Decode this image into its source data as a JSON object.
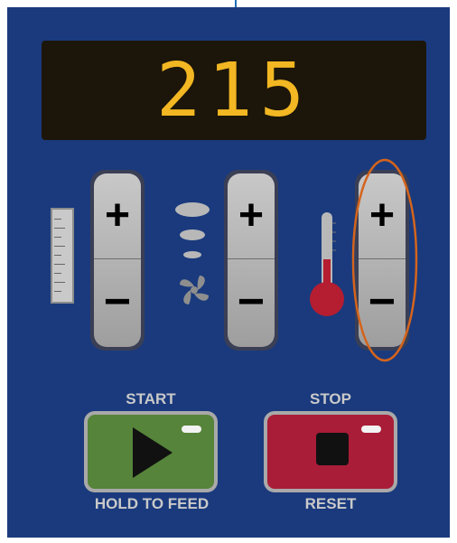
{
  "display": {
    "value": "215"
  },
  "rockers": [
    {
      "plus": "+",
      "minus": "−",
      "icon": "ruler-icon"
    },
    {
      "plus": "+",
      "minus": "−",
      "icon": "fan-icon"
    },
    {
      "plus": "+",
      "minus": "−",
      "icon": "thermometer-icon"
    }
  ],
  "buttons": {
    "start_label": "START",
    "feed_label": "HOLD TO FEED",
    "stop_label": "STOP",
    "reset_label": "RESET"
  },
  "colors": {
    "panel": "#1a3a7d",
    "display_text": "#f2b722",
    "start_button": "#56843a",
    "stop_button": "#a91d38",
    "highlight": "#d4641c"
  }
}
